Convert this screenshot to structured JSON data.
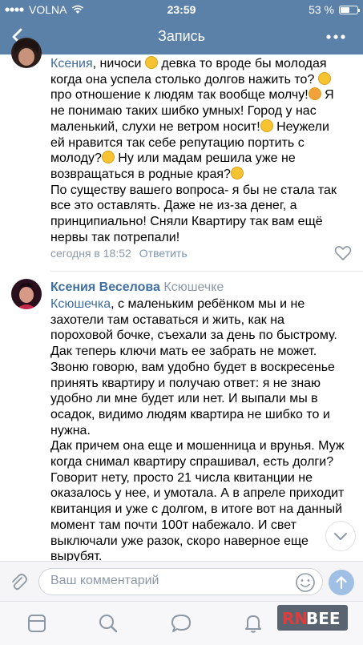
{
  "status_bar": {
    "carrier": "VOLNA",
    "time": "23:59",
    "battery_text": "53 %",
    "battery_level": 0.53
  },
  "nav": {
    "title": "Запись"
  },
  "comment1": {
    "addressee": "Ксения",
    "lines": [
      ", ничоси",
      " девка то вроде бы молодая",
      "когда она успела столько долгов нажить то?",
      "про отношение к людям так вообще молчу!",
      " Я",
      "не понимаю таких шибко умных! Город у нас",
      "маленький, слухи не ветром носит!",
      " Неужели",
      "ей нравится так себе репутацию портить с",
      "молоду?",
      " Ну или мадам решила уже не",
      "возвращаться в родные края?",
      "По существу вашего вопроса- я бы не стала так",
      "все это оставлять. Даже не из-за денег, а",
      "принципиально! Сняли Квартиру так вам ещё",
      "нервы так потрепали!"
    ],
    "time": "сегодня в 18:52",
    "reply_label": "Ответить"
  },
  "comment2": {
    "author": "Ксения Веселова",
    "reply_to": "Ксюшечке",
    "addressee": "Ксюшечка",
    "lines": [
      ", с маленьким ребёнком мы и не",
      "захотели там оставаться и жить, как на",
      "пороховой бочке, съехали за день по быстрому.",
      "Дак теперь ключи мать ее забрать не может.",
      "Звоню говорю, вам удобно будет в воскресенье",
      "принять квартиру и получаю ответ: я не знаю",
      "удобно ли мне будет или нет. И выпали мы в",
      "осадок, видимо людям квартира не шибко то и",
      "нужна.",
      "Дак причем она еще и мошенница и врунья. Муж",
      "когда снимал квартиру спрашивал, есть долги?",
      "Говорит нету, просто 21 числа квитанции не",
      "оказалось у нее, и умотала. А в апреле приходит",
      "квитанция и уже с долгом, в итоге вот на данный",
      "момент там почти 100т набежало. И свет",
      "выключали уже разок, скоро наверное еще",
      "вырубят."
    ]
  },
  "composer": {
    "placeholder": "Ваш комментарий"
  },
  "watermark": {
    "part1": "RN",
    "part2": "BEE"
  },
  "icons": {
    "back": "chevron-left-icon",
    "more": "more-dots-icon",
    "attach": "paperclip-icon",
    "emoji": "smiley-icon",
    "send": "arrow-up-icon",
    "like": "heart-icon",
    "expand": "chevron-down-icon",
    "tabs": [
      "news-icon",
      "search-icon",
      "messages-icon",
      "notifications-icon",
      "menu-icon"
    ]
  },
  "colors": {
    "header": "#5b81a8",
    "link": "#3f6ea0",
    "meta": "#8d98a6",
    "emoji": "#f7c331"
  }
}
